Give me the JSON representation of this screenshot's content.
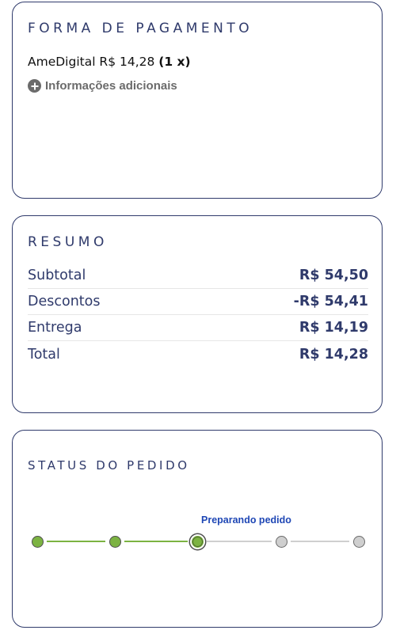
{
  "payment": {
    "title": "FORMA DE PAGAMENTO",
    "method_line": "AmeDigital R$ 14,28 ",
    "installments": "(1 x)",
    "more_info_label": "Informações adicionais"
  },
  "summary": {
    "title": "RESUMO",
    "rows": [
      {
        "label": "Subtotal",
        "value": "R$ 54,50"
      },
      {
        "label": "Descontos",
        "value": "-R$ 54,41"
      },
      {
        "label": "Entrega",
        "value": "R$ 14,19"
      },
      {
        "label": "Total",
        "value": "R$ 14,28"
      }
    ]
  },
  "status": {
    "title": "STATUS DO PEDIDO",
    "current_label": "Preparando pedido",
    "steps_total": 5,
    "current_step": 3,
    "colors": {
      "done": "#7cb342",
      "pending": "#cfcfcf",
      "current_label": "#1f47b5",
      "brand": "#2f3a6b"
    }
  }
}
